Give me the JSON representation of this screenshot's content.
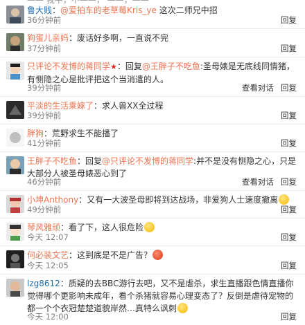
{
  "top_partial": "—— 我中，不——， ——，——",
  "comments": [
    {
      "name": "鲁大贱",
      "sep": "：",
      "mention": "@爱拍车的老草莓Kris_ye",
      "text": " 这次二师兄中招",
      "time": "36分钟前",
      "actions": [
        "回复"
      ]
    },
    {
      "name": "狗蛋儿亲妈",
      "sep": "：",
      "mention": "",
      "text": "废话好多啊，一直说不完",
      "time": "37分钟前",
      "actions": [
        "回复"
      ]
    },
    {
      "name": "只评论不发博的蒋同学",
      "sep": "：回复",
      "mention": "@王胖子不吃鱼",
      "text": ":圣母婊是无底线同情猪，有恻隐之心是批评把这个当消遣的人。",
      "time": "39分钟前",
      "actions": [
        "查看对话",
        "回复"
      ]
    },
    {
      "name": "平淡的生活乘嫁了",
      "sep": "：",
      "mention": "",
      "text": "求人兽XX全过程",
      "time": "39分钟前",
      "actions": [
        "回复"
      ]
    },
    {
      "name": "胖狗",
      "sep": "：",
      "mention": "",
      "text": "荒野求生不能播了",
      "time": "41分钟前",
      "actions": [
        "回复"
      ]
    },
    {
      "name": "王胖子不吃鱼",
      "sep": "：回复",
      "mention": "@只评论不发博的蒋同学",
      "text": ":并不是没有恻隐之心，只是大部分人被圣母婊恶心到了",
      "time": "46分钟前",
      "actions": [
        "查看对话",
        "回复"
      ]
    },
    {
      "name": "小坤Anthony",
      "sep": "：",
      "mention": "",
      "text": "又有一大波圣母即将到达战场，非爱狗人士速度撤离",
      "time": "49分钟前",
      "actions": [
        "回复"
      ]
    },
    {
      "name": "琴风雅顽",
      "sep": "：",
      "mention": "",
      "text": "看了下，这人很危险",
      "time": "今天 12:07",
      "actions": [
        "回复"
      ]
    },
    {
      "name": "何必装文艺",
      "sep": "：",
      "mention": "",
      "text": "这到底是不是广告？",
      "time": "今天 12:05",
      "actions": [
        "回复"
      ]
    },
    {
      "name": "lzg8612",
      "sep": "：",
      "mention": "",
      "text": "质疑的去BBC游行去吧，又不是虐杀，求生直播跟色情直播你觉得哪个更影响未成年，看个杀猪就容易心理变态了？反倒是虐待宠物的都一个个衣冠楚楚道貌岸然…真特么讽刺",
      "time": "今天 12:00",
      "actions": [
        "回复"
      ]
    }
  ],
  "colors": {
    "name": "#eb7350",
    "link": "#eb7350",
    "time": "#808080",
    "divider": "#e8e8e8"
  }
}
